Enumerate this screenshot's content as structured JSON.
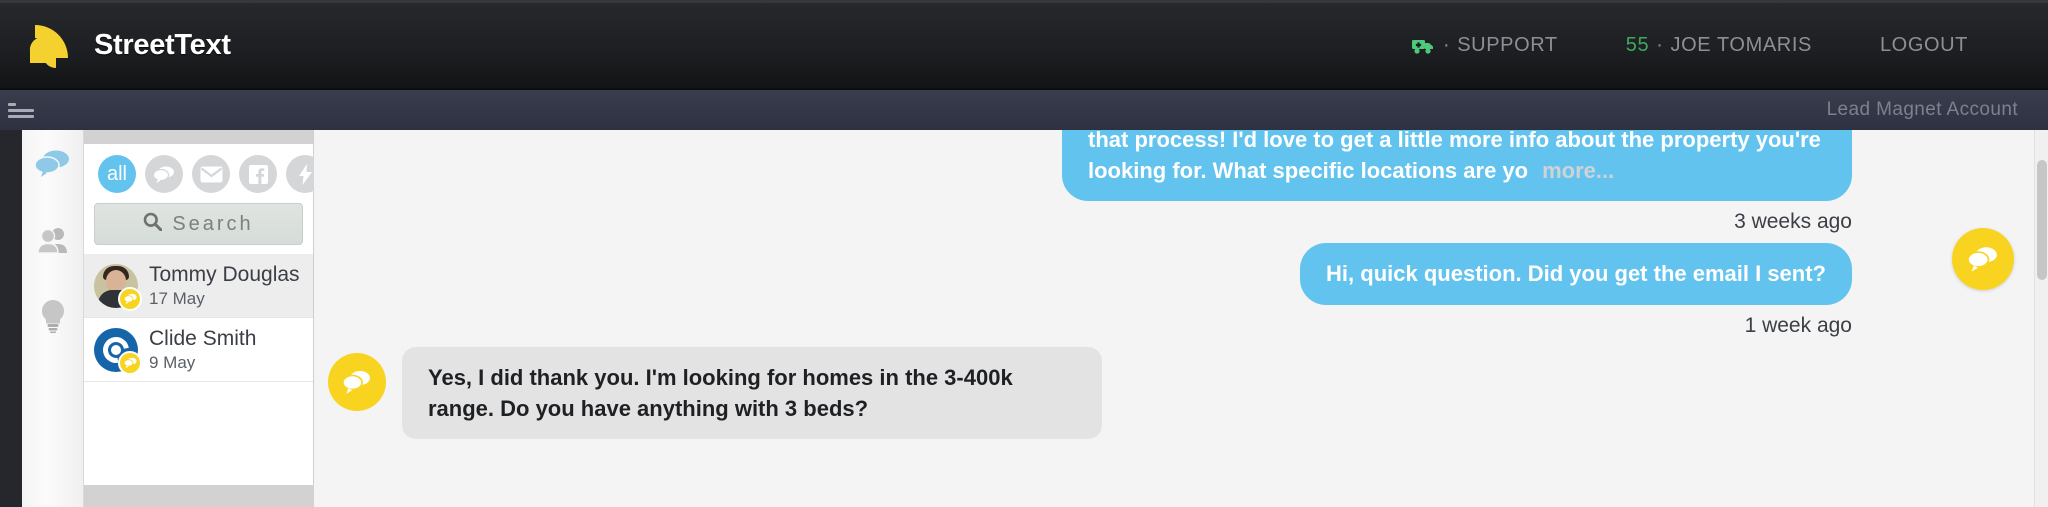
{
  "topnav": {
    "brand": "StreetText",
    "logo_color": "#f5d130",
    "support": {
      "label": "SUPPORT",
      "icon": "ambulance-icon",
      "separator": "·",
      "icon_color": "#4cc97a"
    },
    "user": {
      "count": "55",
      "separator": "·",
      "name": "JOE TOMARIS",
      "count_color": "#3fa85f"
    },
    "logout": "LOGOUT"
  },
  "subbar": {
    "menu_icon": "hamburger-menu-icon",
    "account": "Lead Magnet Account"
  },
  "rail": {
    "items": [
      {
        "icon": "chat-bubbles-icon",
        "active": true,
        "color": "#8fc9e8"
      },
      {
        "icon": "people-icon",
        "active": false,
        "color": "#bdbdbd"
      },
      {
        "icon": "lightbulb-icon",
        "active": false,
        "color": "#c4c4c4"
      }
    ]
  },
  "list": {
    "filters": [
      {
        "name": "filter-all",
        "label": "all",
        "icon": "",
        "active": true
      },
      {
        "name": "filter-sms",
        "label": "",
        "icon": "chat-bubbles-icon",
        "active": false
      },
      {
        "name": "filter-email",
        "label": "",
        "icon": "envelope-icon",
        "active": false
      },
      {
        "name": "filter-facebook",
        "label": "",
        "icon": "facebook-icon",
        "active": false
      },
      {
        "name": "filter-activity",
        "label": "",
        "icon": "bolt-icon",
        "active": false
      }
    ],
    "search": {
      "placeholder": "Search",
      "icon": "search-icon",
      "value": ""
    },
    "conversations": [
      {
        "name": "Tommy Douglas",
        "date": "17 May",
        "avatar": "photo",
        "badge": "chat-bubble-badge",
        "selected": true
      },
      {
        "name": "Clide Smith",
        "date": "9 May",
        "avatar": "logo",
        "badge": "chat-bubble-badge",
        "selected": false
      }
    ]
  },
  "chat": {
    "messages": [
      {
        "direction": "outgoing",
        "clipped_top": true,
        "text": "that process! I'd love to get a little more info about the property you're looking for. What specific locations are yo",
        "more_label": "more...",
        "timestamp": "3 weeks ago"
      },
      {
        "direction": "outgoing",
        "clipped_top": false,
        "text": "Hi, quick question. Did you get the email I sent?",
        "more_label": "",
        "timestamp": "1 week ago"
      },
      {
        "direction": "incoming",
        "clipped_top": false,
        "icon": "chat-bubble-icon",
        "text": "Yes, I did thank you. I'm looking for homes in the 3-400k range. Do you have anything with 3 beds?",
        "more_label": "",
        "timestamp": ""
      }
    ],
    "float_button_icon": "chat-bubble-icon",
    "outgoing_color": "#62c3ef",
    "incoming_color": "#e3e3e3",
    "accent_yellow": "#f8d420"
  }
}
